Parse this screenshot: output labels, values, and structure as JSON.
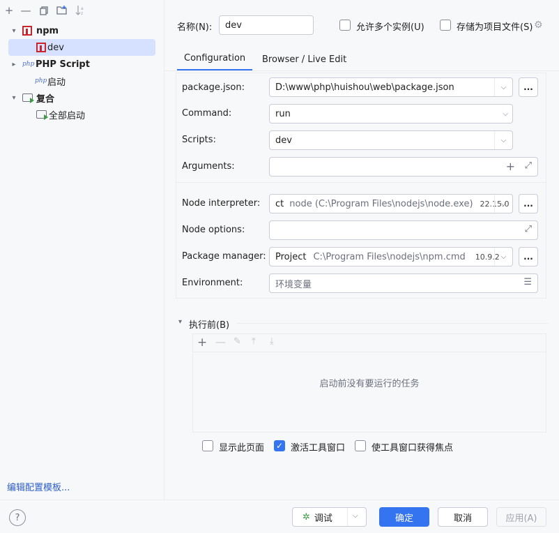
{
  "left": {
    "toolbar": [
      "add-icon",
      "remove-icon",
      "copy-icon",
      "new-folder-icon",
      "sort-icon"
    ],
    "tree": [
      {
        "label": "npm",
        "bold": true,
        "icon": "npm-icon"
      },
      {
        "label": "dev",
        "bold": false,
        "icon": "npm-icon",
        "selected": true
      },
      {
        "label": "PHP Script",
        "bold": true,
        "icon": "php-icon"
      },
      {
        "label": "启动",
        "bold": false,
        "icon": "php-icon"
      },
      {
        "label": "复合",
        "bold": true,
        "icon": "compound-icon"
      },
      {
        "label": "全部启动",
        "bold": false,
        "icon": "compound-icon"
      }
    ],
    "edit_templates": "编辑配置模板..."
  },
  "header": {
    "name_label": "名称(N):",
    "name_value": "dev",
    "allow_multiple": "允许多个实例(U)",
    "store_as_file": "存储为项目文件(S)"
  },
  "tabs": [
    "Configuration",
    "Browser / Live Edit"
  ],
  "form": {
    "package_json": {
      "label": "package.json:",
      "value": "D:\\www\\php\\huishou\\web\\package.json"
    },
    "command": {
      "label": "Command:",
      "value": "run"
    },
    "scripts": {
      "label": "Scripts:",
      "value": "dev"
    },
    "arguments": {
      "label": "Arguments:",
      "value": ""
    },
    "node_interpreter": {
      "label": "Node interpreter:",
      "prefix": "ct",
      "path": "node (C:\\Program Files\\nodejs\\node.exe)",
      "version": "22.15.0"
    },
    "node_options": {
      "label": "Node options:",
      "value": ""
    },
    "package_manager": {
      "label": "Package manager:",
      "prefix": "Project",
      "path": "C:\\Program Files\\nodejs\\npm.cmd",
      "version": "10.9.2"
    },
    "environment": {
      "label": "Environment:",
      "placeholder": "环境变量"
    }
  },
  "before_launch": {
    "title": "执行前(B)",
    "empty": "启动前没有要运行的任务",
    "show_page": "显示此页面",
    "activate_tool_window": "激活工具窗口",
    "focus_tool_window": "使工具窗口获得焦点"
  },
  "footer": {
    "debug": "调试",
    "ok": "确定",
    "cancel": "取消",
    "apply": "应用(A)"
  },
  "colors": {
    "accent": "#3574f0",
    "npm": "#c8262c",
    "selection": "#d5e1ff"
  }
}
